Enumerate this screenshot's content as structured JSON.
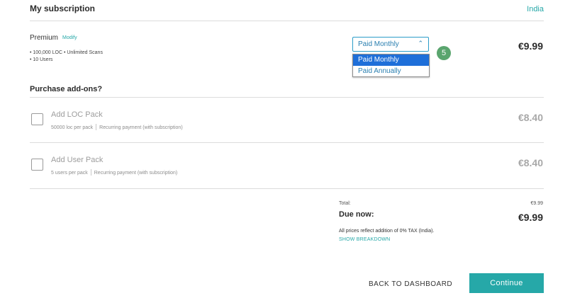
{
  "header": {
    "title": "My subscription",
    "country_link": "India"
  },
  "plan": {
    "name": "Premium",
    "modify_label": "Modify",
    "features": [
      "• 100,000 LOC • Unlimited Scans",
      "• 10 Users"
    ],
    "billing": {
      "selected": "Paid Monthly",
      "options": [
        "Paid Monthly",
        "Paid Annually"
      ],
      "dropdown_open": true
    },
    "step_badge": "5",
    "price": "€9.99"
  },
  "addons": {
    "heading": "Purchase add-ons?",
    "items": [
      {
        "name": "Add LOC Pack",
        "detail": "50000 loc per pack",
        "recurring": "Recurring payment (with subscription)",
        "price": "€8.40",
        "checked": false
      },
      {
        "name": "Add User Pack",
        "detail": "5 users per pack",
        "recurring": "Recurring payment (with subscription)",
        "price": "€8.40",
        "checked": false
      }
    ]
  },
  "summary": {
    "total_label": "Total:",
    "total_value": "€9.99",
    "due_label": "Due now:",
    "due_value": "€9.99",
    "tax_note": "All prices reflect addition of 0% TAX (India).",
    "breakdown_link": "SHOW BREAKDOWN"
  },
  "actions": {
    "back_label": "BACK TO DASHBOARD",
    "continue_label": "Continue"
  },
  "colors": {
    "accent": "#26a8a8",
    "select_highlight": "#1e6fd9",
    "step_badge": "#5aa56e"
  }
}
